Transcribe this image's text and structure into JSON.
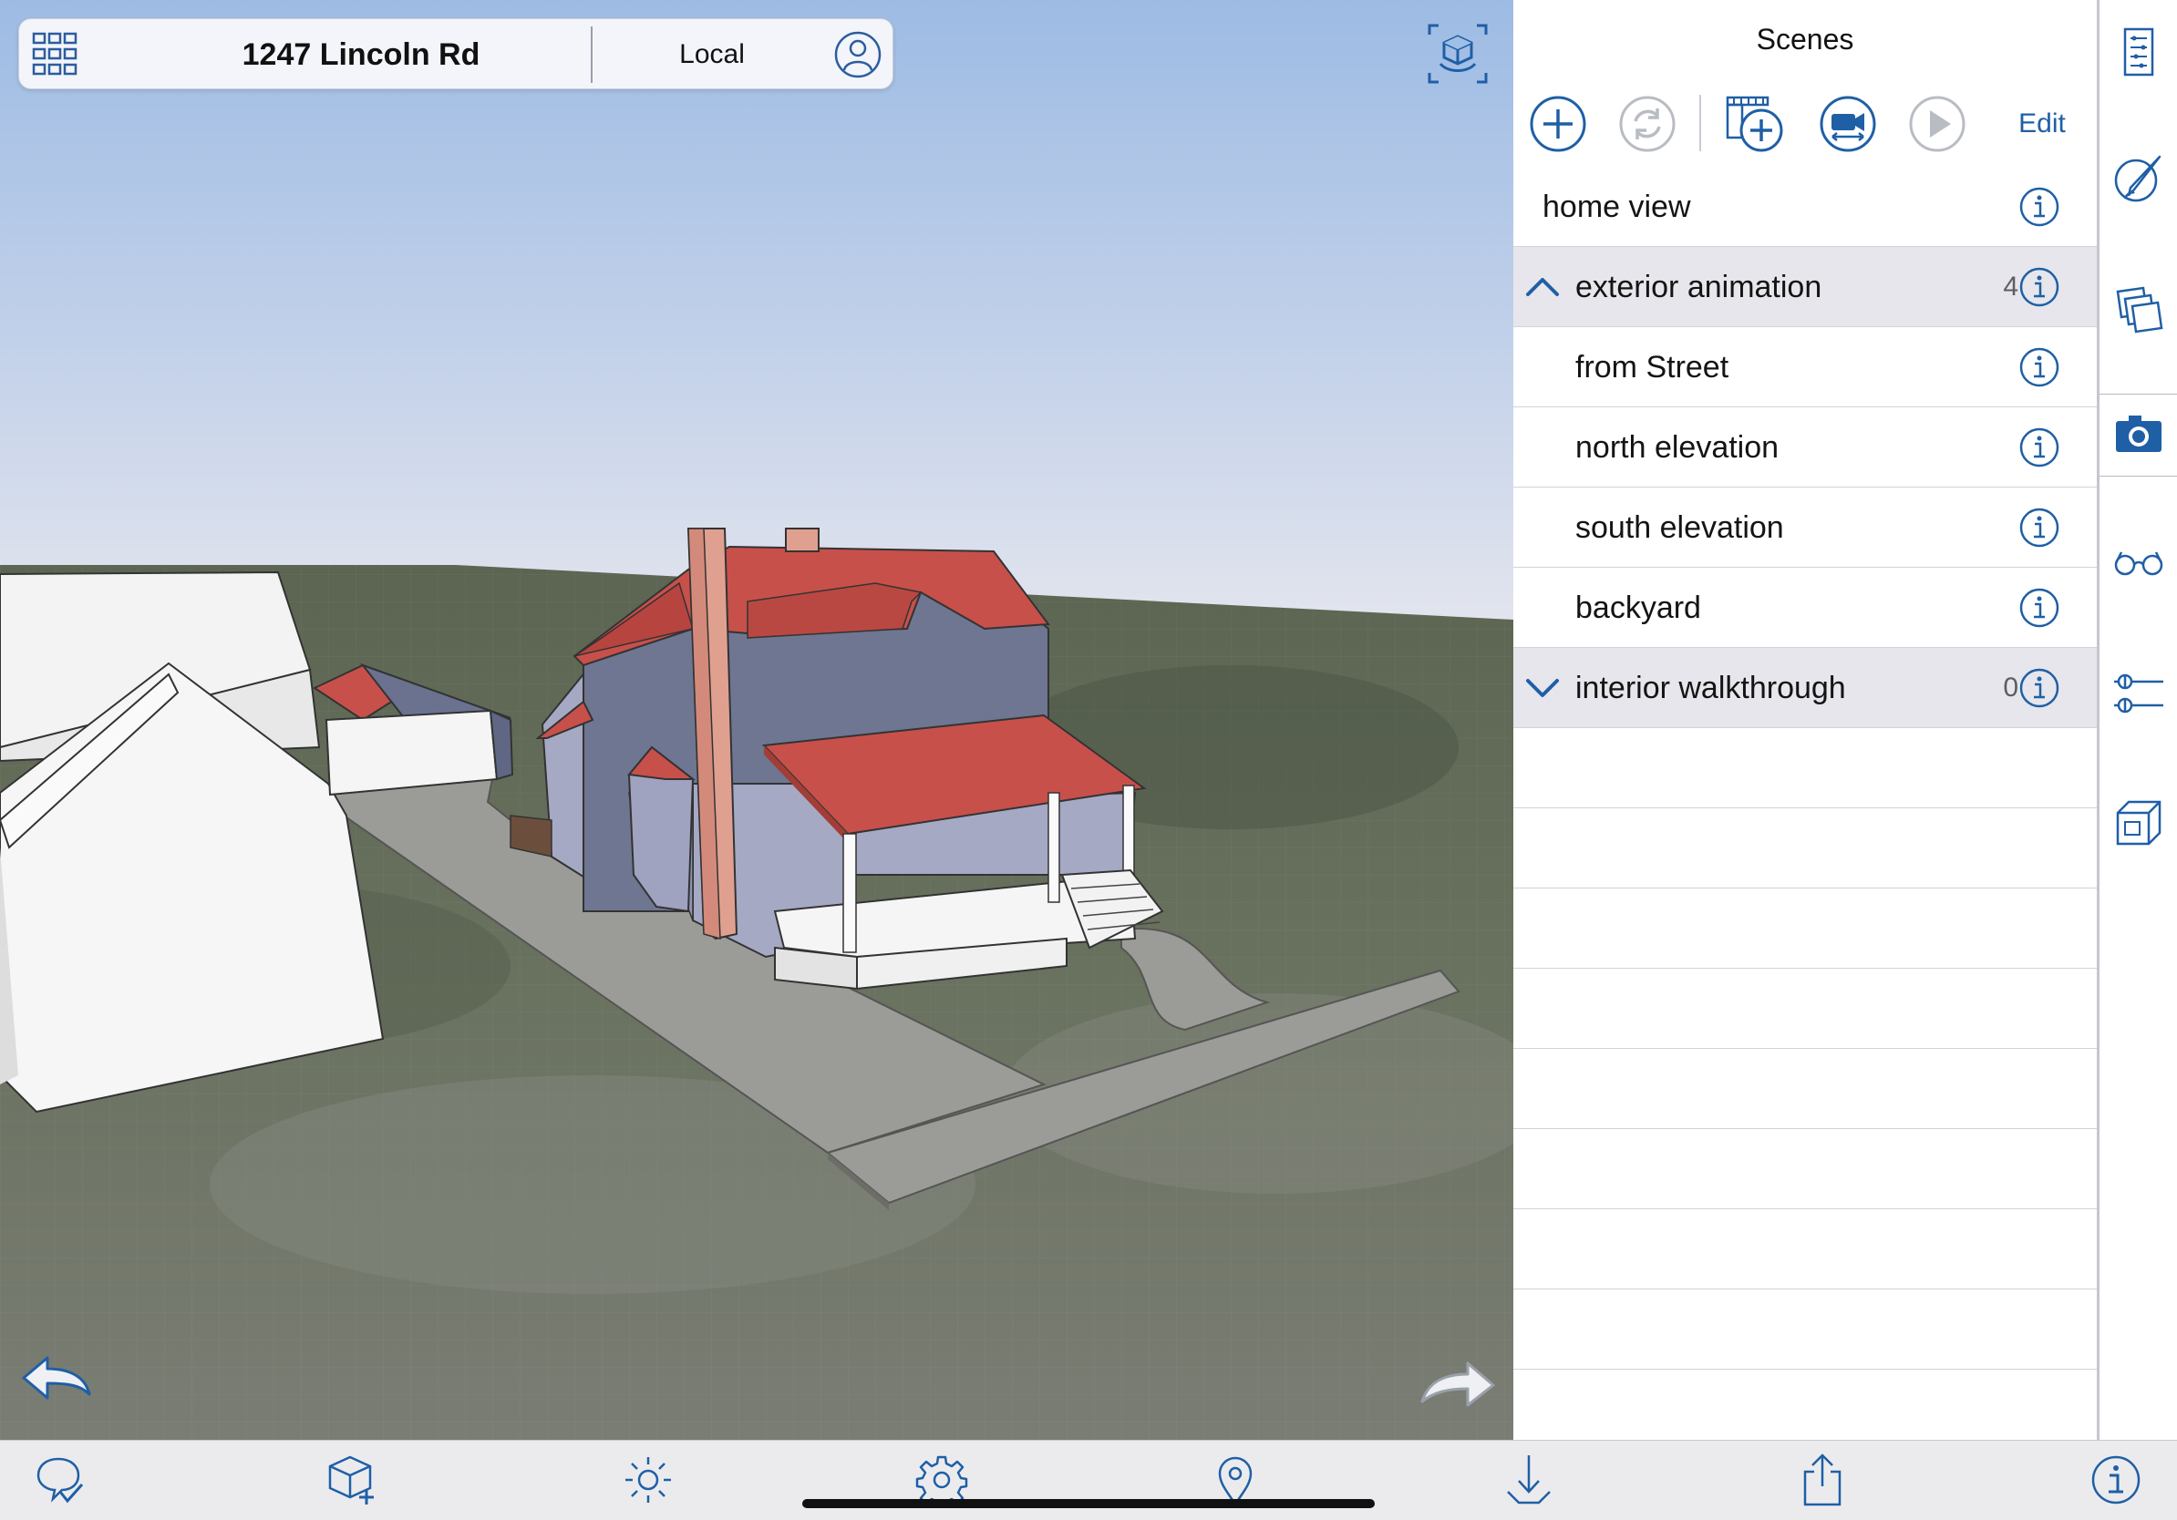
{
  "topbar": {
    "grid_icon": "grid-icon",
    "title": "1247 Lincoln Rd",
    "location": "Local",
    "profile_icon": "person-icon"
  },
  "viewport": {
    "orbit_icon": "cube-orbit-icon",
    "undo_icon": "undo-arrow-icon",
    "redo_icon": "redo-arrow-icon"
  },
  "panel": {
    "title": "Scenes",
    "tools": [
      "add-circle-icon",
      "refresh-circle-icon",
      "film-add-icon",
      "camera-move-icon",
      "play-circle-icon"
    ],
    "edit_label": "Edit",
    "rows": [
      {
        "label": "home view",
        "type": "scene"
      },
      {
        "label": "exterior animation",
        "type": "group",
        "expanded": true,
        "count": "4"
      },
      {
        "label": "from Street",
        "type": "child"
      },
      {
        "label": "north elevation",
        "type": "child"
      },
      {
        "label": "south elevation",
        "type": "child"
      },
      {
        "label": "backyard",
        "type": "child"
      },
      {
        "label": "interior walkthrough",
        "type": "group",
        "expanded": false,
        "count": "0"
      }
    ]
  },
  "rail": {
    "icons": [
      "outliner-icon",
      "styles-brush-icon",
      "layers-icon",
      "scenes-camera-icon",
      "xray-glasses-icon",
      "section-planes-icon",
      "components-box-icon"
    ],
    "active": "scenes-camera-icon"
  },
  "bottombar": {
    "icons": [
      "markup-check-icon",
      "add-object-icon",
      "sun-icon",
      "settings-gear-icon",
      "location-pin-icon",
      "download-icon",
      "share-icon",
      "info-icon"
    ]
  },
  "colors": {
    "accent": "#1f5fa6",
    "roof": "#c8504a",
    "chimney": "#e0a090",
    "wall": "#6e7692",
    "ground": "#6a7260",
    "sky_top": "#9ebde6",
    "sky_bottom": "#e4e6ee",
    "group_row_bg": "#e7e6ec"
  }
}
